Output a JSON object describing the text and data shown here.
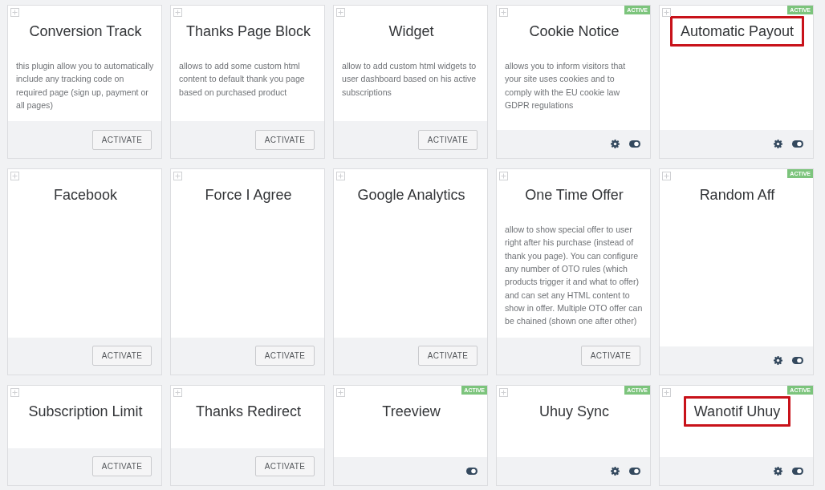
{
  "cards": [
    {
      "title": "Conversion Track",
      "description": "this plugin allow you to automatically include any tracking code on required page (sign up, payment or all pages)",
      "active": false,
      "button": "ACTIVATE",
      "settings": false,
      "highlighted": false
    },
    {
      "title": "Thanks Page Block",
      "description": "allows to add some custom html content to default thank you page based on purchased product",
      "active": false,
      "button": "ACTIVATE",
      "settings": false,
      "highlighted": false
    },
    {
      "title": "Widget",
      "description": "allow to add custom html widgets to user dashboard based on his active subscriptions",
      "active": false,
      "button": "ACTIVATE",
      "settings": false,
      "highlighted": false
    },
    {
      "title": "Cookie Notice",
      "description": "allows you to inform visitors that your site uses cookies and to comply with the EU cookie law GDPR regulations",
      "active": true,
      "badge": "ACTIVE",
      "settings": true,
      "highlighted": false
    },
    {
      "title": "Automatic Payout",
      "active": true,
      "badge": "ACTIVE",
      "settings": true,
      "highlighted": true
    },
    {
      "title": "Facebook",
      "active": false,
      "button": "ACTIVATE",
      "settings": false,
      "highlighted": false
    },
    {
      "title": "Force I Agree",
      "active": false,
      "button": "ACTIVATE",
      "settings": false,
      "highlighted": false
    },
    {
      "title": "Google Analytics",
      "active": false,
      "button": "ACTIVATE",
      "settings": false,
      "highlighted": false
    },
    {
      "title": "One Time Offer",
      "description": "allow to show special offer to user right after his purchase (instead of thank you page). You can configure any number of OTO rules (which products trigger it and what to offer) and can set any HTML content to show in offer. Multiple OTO offer can be chained (shown one after other)",
      "active": false,
      "button": "ACTIVATE",
      "settings": false,
      "highlighted": false
    },
    {
      "title": "Random Aff",
      "active": true,
      "badge": "ACTIVE",
      "settings": true,
      "highlighted": false
    },
    {
      "title": "Subscription Limit",
      "active": false,
      "button": "ACTIVATE",
      "settings": false,
      "highlighted": false
    },
    {
      "title": "Thanks Redirect",
      "active": false,
      "button": "ACTIVATE",
      "settings": false,
      "highlighted": false
    },
    {
      "title": "Treeview",
      "active": true,
      "badge": "ACTIVE",
      "settings": false,
      "highlighted": false
    },
    {
      "title": "Uhuy Sync",
      "active": true,
      "badge": "ACTIVE",
      "settings": true,
      "highlighted": false
    },
    {
      "title": "Wanotif Uhuy",
      "active": true,
      "badge": "ACTIVE",
      "settings": true,
      "highlighted": true
    }
  ]
}
